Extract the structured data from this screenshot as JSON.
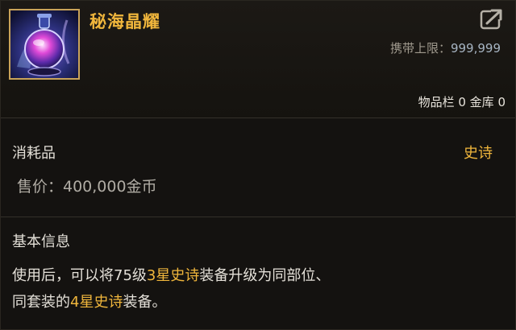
{
  "item": {
    "name": "秘海晶耀",
    "icon": "crystal-potion-icon",
    "carry_limit_label": "携带上限：",
    "carry_limit_value": "999,999",
    "inventory_text": "物品栏 0 金库 0",
    "type": "消耗品",
    "rarity": "史诗",
    "price": "售价：400,000金币"
  },
  "info": {
    "title": "基本信息",
    "desc_part1": "使用后，可以将75级",
    "desc_hl1": "3星史诗",
    "desc_part2": "装备升级为同部位、",
    "desc_part3": "同套装的",
    "desc_hl2": "4星史诗",
    "desc_part4": "装备。"
  },
  "colors": {
    "accent": "#f0b63c",
    "text": "#e4e0d8",
    "muted": "#b0aca4",
    "value": "#a6b4c2",
    "background": "#141210"
  },
  "icons": [
    "crystal-potion-icon",
    "share-icon"
  ]
}
